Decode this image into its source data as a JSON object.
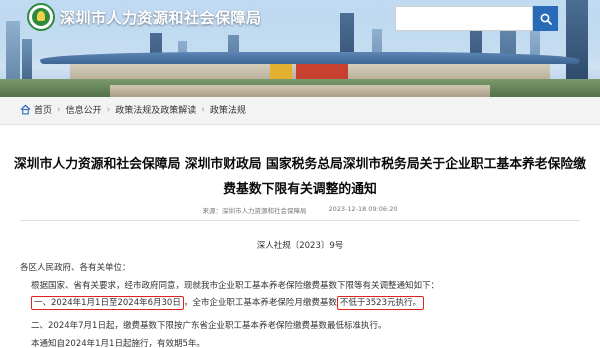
{
  "header": {
    "site_title": "深圳市人力资源和社会保障局",
    "search_icon": "search-icon",
    "emblem_icon": "emblem-icon",
    "accent_color": "#2a6bb8"
  },
  "breadcrumb": {
    "home_icon": "home-icon",
    "items": [
      "首页",
      "信息公开",
      "政策法规及政策解读",
      "政策法规"
    ],
    "separator": "›"
  },
  "article": {
    "title": "深圳市人力资源和社会保障局 深圳市财政局 国家税务总局深圳市税务局关于企业职工基本养老保险缴费基数下限有关调整的通知",
    "source": "来源：深圳市人力资源和社会保障局",
    "date": "2023-12-18 09:06:20",
    "doc_no": "深人社规〔2023〕9号",
    "addressee": "各区人民政府、各有关单位：",
    "intro": "根据国家、省有关要求，经市政府同意，现就我市企业职工基本养老保险缴费基数下限等有关调整通知如下：",
    "item1_prefix": "一、",
    "item1_highlight_a": "2024年1月1日至2024年6月30日",
    "item1_middle": "，全市企业职工基本养老保险月缴费基数",
    "item1_highlight_b": "不低于3523元执行。",
    "item2": "二、2024年7月1日起，缴费基数下限按广东省企业职工基本养老保险缴费基数最低标准执行。",
    "closing": "本通知自2024年1月1日起施行，有效期5年。",
    "highlight_color": "#e0241b"
  }
}
